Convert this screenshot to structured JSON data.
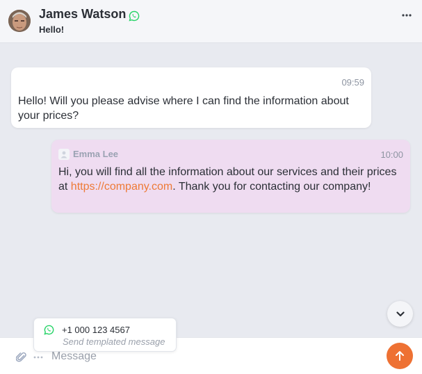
{
  "header": {
    "contact_name": "James Watson",
    "last_message": "Hello!",
    "channel_icon": "whatsapp-icon",
    "more_icon": "more-horizontal-icon"
  },
  "messages": [
    {
      "direction": "incoming",
      "time": "09:59",
      "text": "Hello! Will you please advise where I can find the information about your prices?"
    },
    {
      "direction": "outgoing",
      "sender": "Emma Lee",
      "time": "10:00",
      "text_before": "Hi, you will find all the information about our services and their prices at ",
      "link": "https://company.com",
      "text_after": ". Thank you for contacting our company!"
    }
  ],
  "template_popup": {
    "phone": "+1 000 123 4567",
    "hint": "Send templated message",
    "icon": "whatsapp-icon"
  },
  "composer": {
    "placeholder": "Message",
    "attach_icon": "paperclip-icon",
    "more_icon": "more-horizontal-icon",
    "send_icon": "arrow-up-icon"
  },
  "colors": {
    "accent": "#ee7133",
    "outgoing_bubble": "#efdcf1",
    "whatsapp": "#25d366",
    "link": "#ee7a36"
  }
}
